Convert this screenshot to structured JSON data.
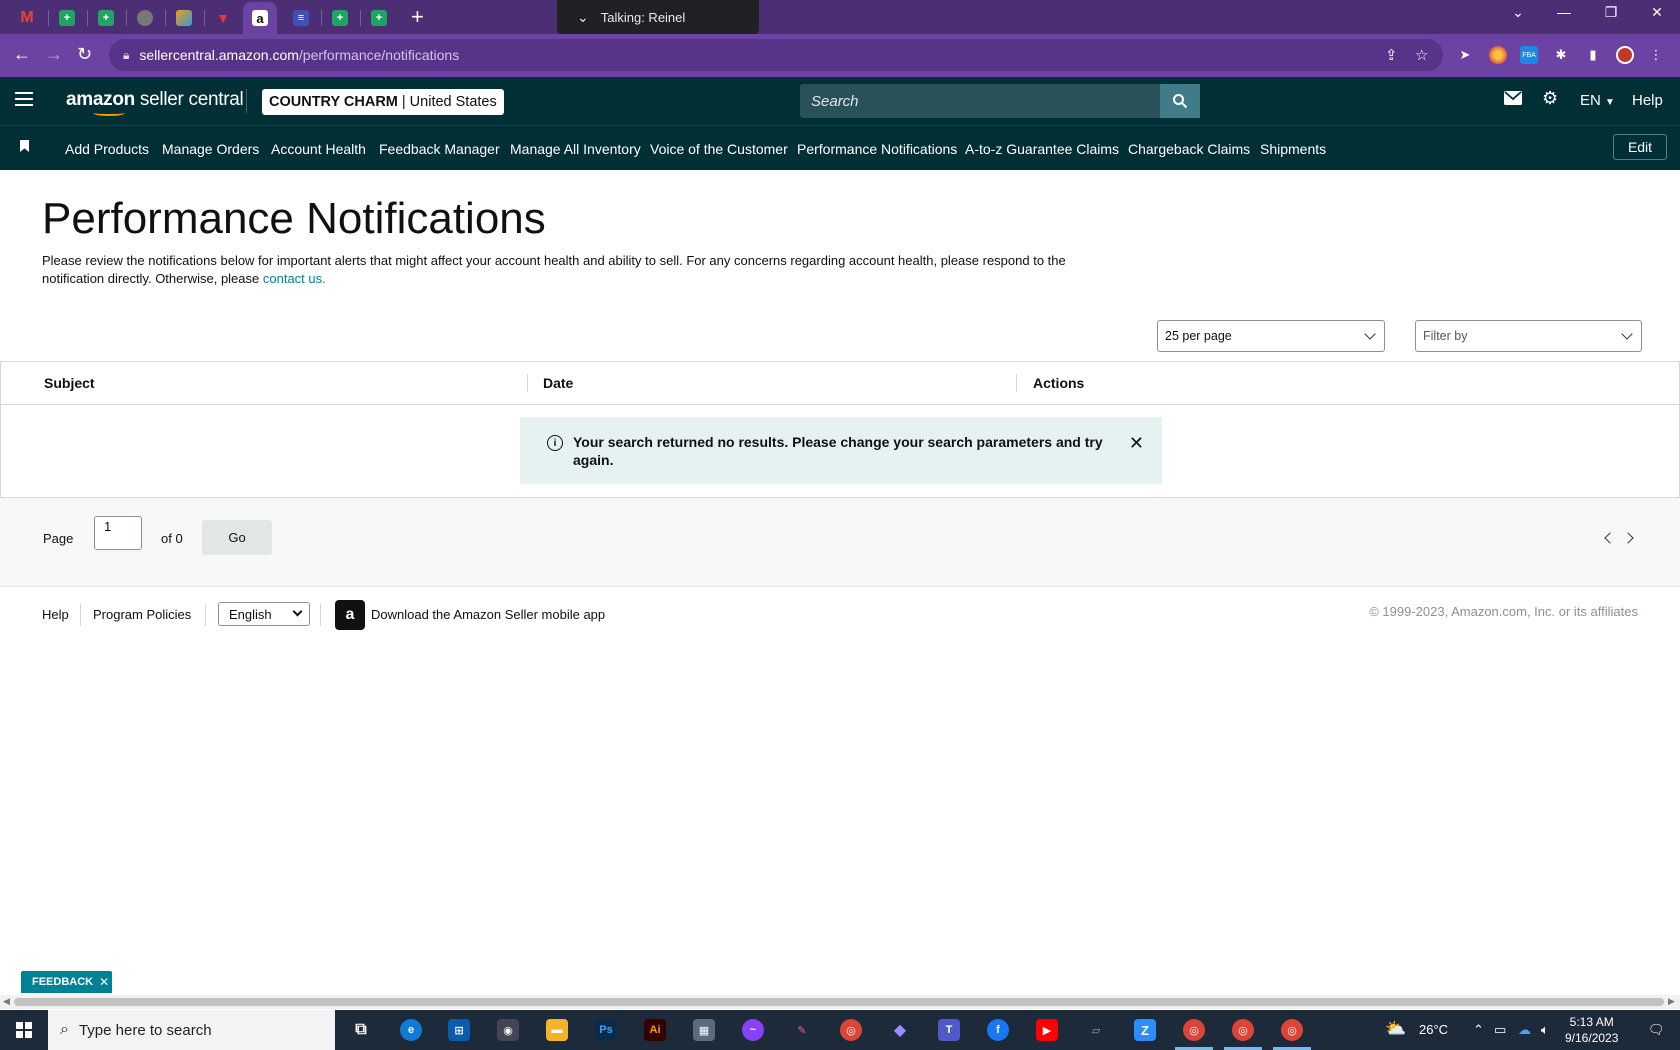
{
  "browser": {
    "url_host": "sellercentral.amazon.com",
    "url_path": "/performance/notifications",
    "talking_label": "Talking: Reinel"
  },
  "header": {
    "logo_brand": "amazon",
    "logo_rest": " seller central",
    "store_name": "COUNTRY CHARM",
    "store_region": "| United States",
    "search_placeholder": "Search",
    "language": "EN",
    "help": "Help"
  },
  "nav": {
    "items": [
      "Add Products",
      "Manage Orders",
      "Account Health",
      "Feedback Manager",
      "Manage All Inventory",
      "Voice of the Customer",
      "Performance Notifications",
      "A-to-z Guarantee Claims",
      "Chargeback Claims",
      "Shipments"
    ],
    "edit": "Edit"
  },
  "main": {
    "title": "Performance Notifications",
    "description": "Please review the notifications below for important alerts that might affect your account health and ability to sell. For any concerns regarding account health, please respond to the notification directly. Otherwise, please ",
    "contact_link": "contact us.",
    "per_page": "25 per page",
    "filter_placeholder": "Filter by",
    "columns": [
      "Subject",
      "Date",
      "Actions"
    ],
    "no_results": "Your search returned no results. Please change your search parameters and try again.",
    "pager": {
      "page_label": "Page",
      "page_value": "1",
      "of_label": "of 0",
      "go": "Go"
    }
  },
  "footer": {
    "help": "Help",
    "policies": "Program Policies",
    "language": "English",
    "app_download": "Download the Amazon Seller mobile app",
    "copyright": "© 1999-2023, Amazon.com, Inc. or its affiliates"
  },
  "feedback_tab": "FEEDBACK",
  "taskbar": {
    "search_placeholder": "Type here to search",
    "weather": "26°C",
    "time": "5:13 AM",
    "date": "9/16/2023"
  },
  "colors": {
    "browser_purple": "#6c43a3",
    "amazon_header": "#002f36",
    "link_teal": "#008296",
    "alert_bg": "#e6f2f2"
  }
}
